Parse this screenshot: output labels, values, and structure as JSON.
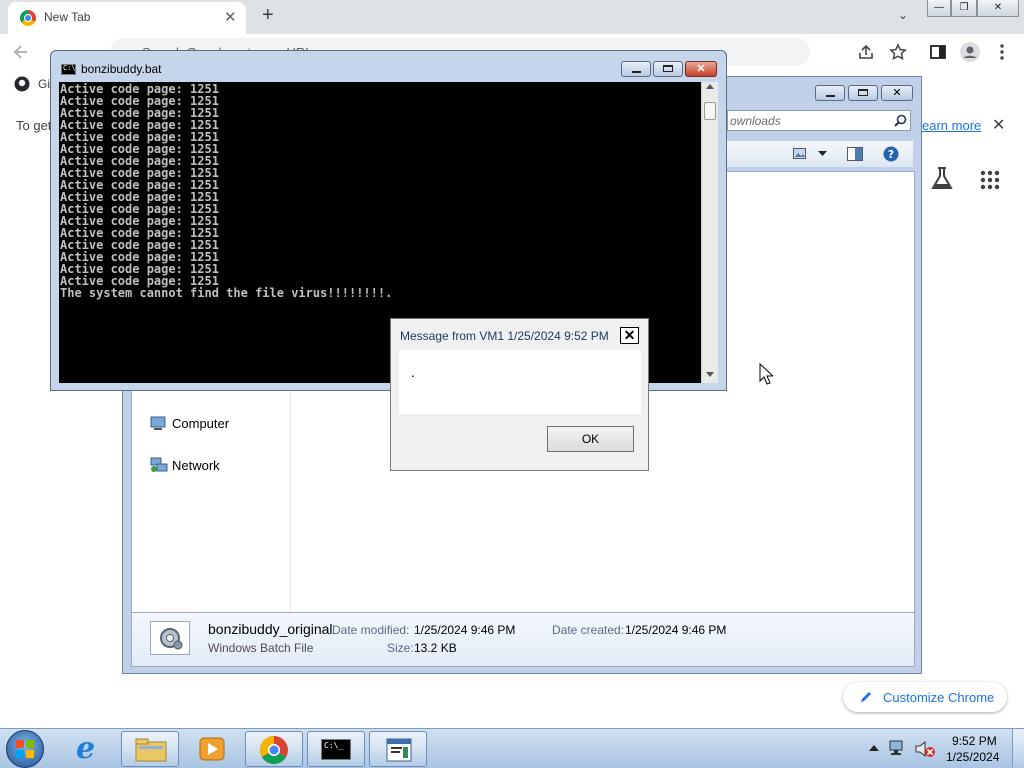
{
  "chrome": {
    "tab_title": "New Tab",
    "tab_close": "✕",
    "new_tab": "+",
    "tab_search": "⌄",
    "omnibox_placeholder": "Search Google or type a URL",
    "bookmark": "Gi",
    "infobar_text": "To get",
    "learn_more": "earn more",
    "infobar_close": "✕",
    "customize_label": "Customize Chrome",
    "window_controls": {
      "minimize": "—",
      "maximize": "❐",
      "close": "✕"
    }
  },
  "explorer": {
    "search_placeholder": "ownloads",
    "nav_items": [
      {
        "label": "Computer"
      },
      {
        "label": "Network"
      }
    ],
    "details": {
      "file_name": "bonzibuddy_original",
      "file_type": "Windows Batch File",
      "date_modified_label": "Date modified:",
      "date_modified": "1/25/2024 9:46 PM",
      "date_created_label": "Date created:",
      "date_created": "1/25/2024 9:46 PM",
      "size_label": "Size:",
      "size": "13.2 KB"
    }
  },
  "console": {
    "title": "bonzibuddy.bat",
    "lines": [
      "Active code page: 1251",
      "Active code page: 1251",
      "Active code page: 1251",
      "Active code page: 1251",
      "Active code page: 1251",
      "Active code page: 1251",
      "Active code page: 1251",
      "Active code page: 1251",
      "Active code page: 1251",
      "Active code page: 1251",
      "Active code page: 1251",
      "Active code page: 1251",
      "Active code page: 1251",
      "Active code page: 1251",
      "Active code page: 1251",
      "Active code page: 1251",
      "Active code page: 1251",
      "The system cannot find the file virus!!!!!!!!."
    ]
  },
  "message_box": {
    "title": "Message from VM1 1/25/2024 9:52 PM",
    "body": ".",
    "ok_label": "OK",
    "close": "✕"
  },
  "taskbar": {
    "time": "9:52 PM",
    "date": "1/25/2024"
  },
  "colors": {
    "chrome_tabstrip": "#dee1e6",
    "console_bg": "#000000",
    "console_text": "#c0c0c0",
    "aero_frame": "#c6d6ea"
  }
}
